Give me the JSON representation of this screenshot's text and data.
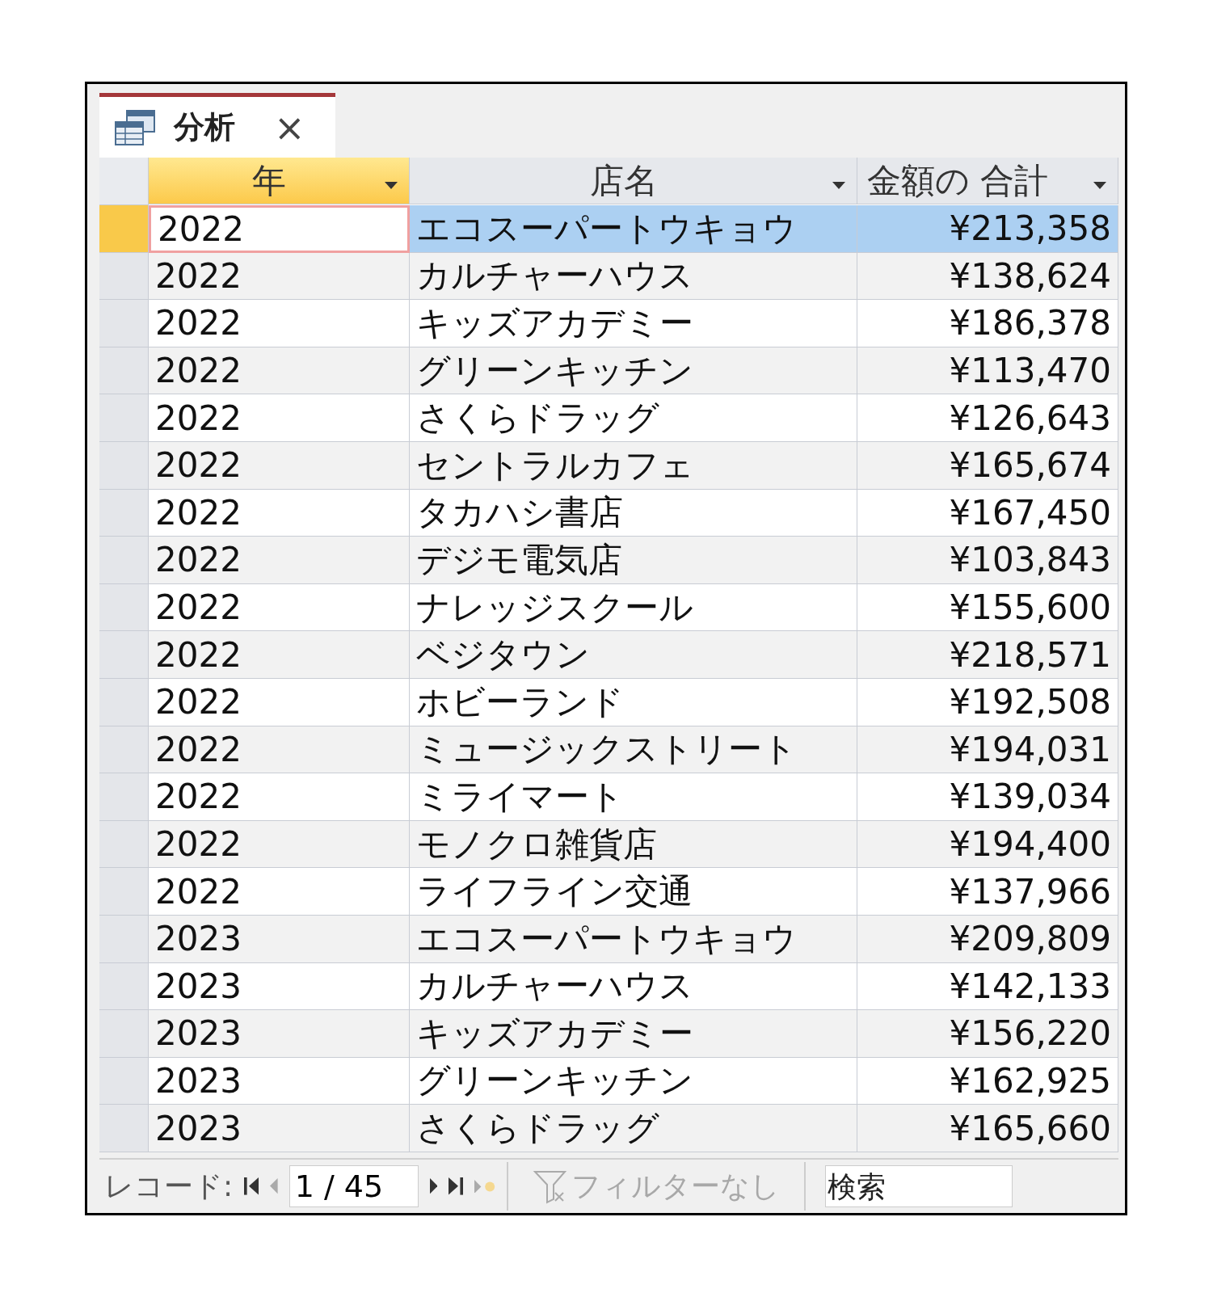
{
  "tab": {
    "title": "分析",
    "close": "×"
  },
  "columns": [
    {
      "label": "年",
      "selected": true,
      "kind": "text"
    },
    {
      "label": "店名",
      "selected": false,
      "kind": "text"
    },
    {
      "label": "金額の 合計",
      "selected": false,
      "kind": "number"
    }
  ],
  "rows": [
    {
      "cells": [
        "2022",
        "エコスーパートウキョウ",
        "¥213,358"
      ],
      "selected": true
    },
    {
      "cells": [
        "2022",
        "カルチャーハウス",
        "¥138,624"
      ],
      "selected": false
    },
    {
      "cells": [
        "2022",
        "キッズアカデミー",
        "¥186,378"
      ],
      "selected": false
    },
    {
      "cells": [
        "2022",
        "グリーンキッチン",
        "¥113,470"
      ],
      "selected": false
    },
    {
      "cells": [
        "2022",
        "さくらドラッグ",
        "¥126,643"
      ],
      "selected": false
    },
    {
      "cells": [
        "2022",
        "セントラルカフェ",
        "¥165,674"
      ],
      "selected": false
    },
    {
      "cells": [
        "2022",
        "タカハシ書店",
        "¥167,450"
      ],
      "selected": false
    },
    {
      "cells": [
        "2022",
        "デジモ電気店",
        "¥103,843"
      ],
      "selected": false
    },
    {
      "cells": [
        "2022",
        "ナレッジスクール",
        "¥155,600"
      ],
      "selected": false
    },
    {
      "cells": [
        "2022",
        "ベジタウン",
        "¥218,571"
      ],
      "selected": false
    },
    {
      "cells": [
        "2022",
        "ホビーランド",
        "¥192,508"
      ],
      "selected": false
    },
    {
      "cells": [
        "2022",
        "ミュージックストリート",
        "¥194,031"
      ],
      "selected": false
    },
    {
      "cells": [
        "2022",
        "ミライマート",
        "¥139,034"
      ],
      "selected": false
    },
    {
      "cells": [
        "2022",
        "モノクロ雑貨店",
        "¥194,400"
      ],
      "selected": false
    },
    {
      "cells": [
        "2022",
        "ライフライン交通",
        "¥137,966"
      ],
      "selected": false
    },
    {
      "cells": [
        "2023",
        "エコスーパートウキョウ",
        "¥209,809"
      ],
      "selected": false
    },
    {
      "cells": [
        "2023",
        "カルチャーハウス",
        "¥142,133"
      ],
      "selected": false
    },
    {
      "cells": [
        "2023",
        "キッズアカデミー",
        "¥156,220"
      ],
      "selected": false
    },
    {
      "cells": [
        "2023",
        "グリーンキッチン",
        "¥162,925"
      ],
      "selected": false
    },
    {
      "cells": [
        "2023",
        "さくらドラッグ",
        "¥165,660"
      ],
      "selected": false
    }
  ],
  "navigation": {
    "label": "レコード:",
    "position": "1 / 45",
    "buttons": [
      {
        "kind": "first",
        "disabled": false
      },
      {
        "kind": "prev",
        "disabled": true
      }
    ],
    "buttons_after": [
      {
        "kind": "next",
        "disabled": false
      },
      {
        "kind": "last",
        "disabled": false
      },
      {
        "kind": "new",
        "disabled": true
      }
    ],
    "filter": {
      "label": "フィルターなし",
      "disabled": true
    },
    "search": {
      "placeholder": "検索"
    }
  }
}
